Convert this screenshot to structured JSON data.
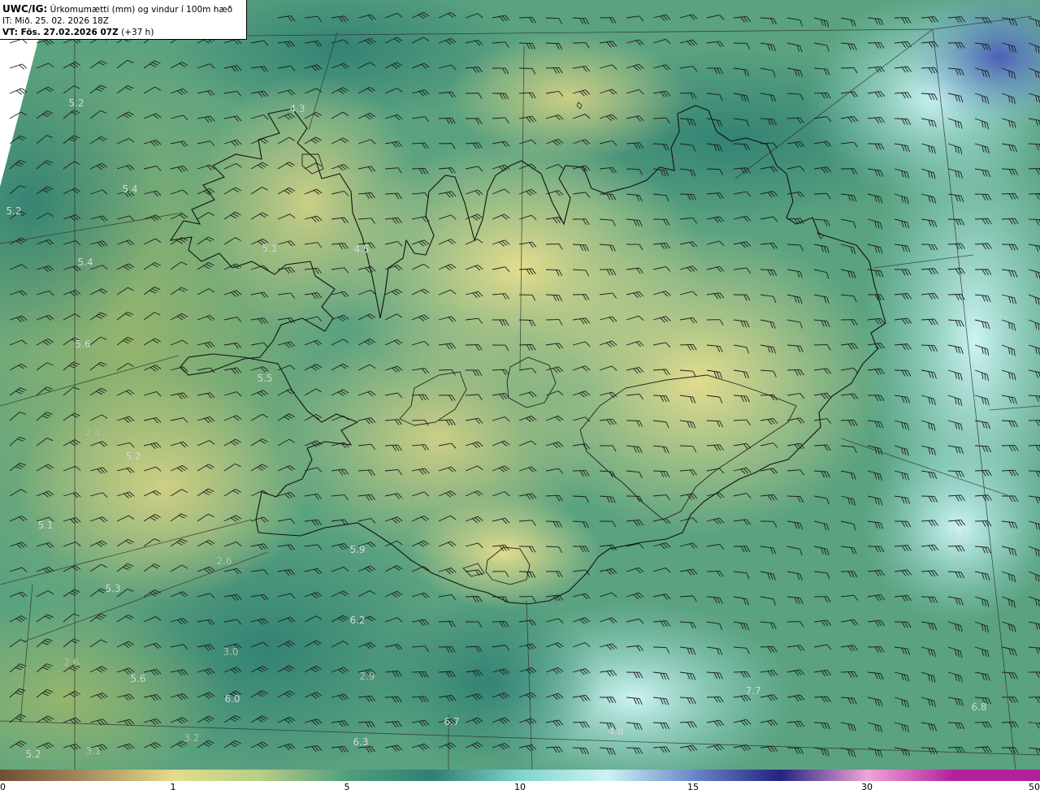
{
  "header": {
    "code": "UWC/IG:",
    "description": "Úrkomumætti (mm) og vindur í 100m hæð",
    "initial_time": "IT: Mið. 25. 02. 2026 18Z",
    "valid_prefix": "VT: Fös. 27.02.2026 07Z",
    "valid_offset": "(+37 h)"
  },
  "map_labels": [
    "5.2",
    "4.3",
    "5.4",
    "5.2",
    "4.5",
    "5.1",
    "5.4",
    "5.6",
    "5.5",
    "2.4",
    "5.2",
    "5.1",
    "2.6",
    "5.9",
    "5.3",
    "6.2",
    "3.0",
    "2.6",
    "5.6",
    "2.9",
    "6.0",
    "6.7",
    "3.2",
    "6.3",
    "4.8",
    "7.7",
    "3.1",
    "6.8",
    "5.2",
    "3.1"
  ],
  "colorbar": {
    "ticks": [
      "0",
      "1",
      "5",
      "10",
      "15",
      "30",
      "50"
    ],
    "colors": [
      "#6e4f33",
      "#a58f5f",
      "#e3dd8a",
      "#b8cd86",
      "#4f9e7c",
      "#2f7f72",
      "#7fd4cc",
      "#cdf4f2",
      "#6b86c9",
      "#22237e",
      "#efa5d8",
      "#b2219a"
    ]
  }
}
